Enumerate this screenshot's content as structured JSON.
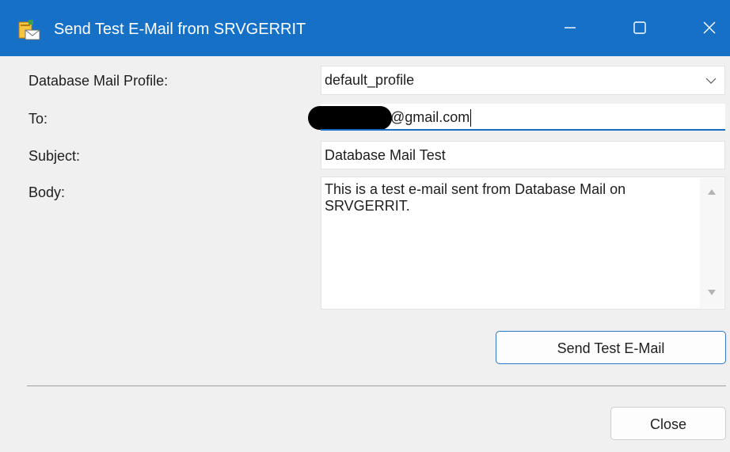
{
  "window": {
    "title": "Send Test E-Mail from SRVGERRIT",
    "controls": [
      "minimize-icon",
      "maximize-icon",
      "close-icon"
    ]
  },
  "form": {
    "profile_label": "Database Mail Profile:",
    "profile_value": "default_profile",
    "to_label": "To:",
    "to_value": "@gmail.com",
    "subject_label": "Subject:",
    "subject_value": "Database Mail Test",
    "body_label": "Body:",
    "body_value": "This is a test e-mail sent from Database Mail on SRVGERRIT."
  },
  "buttons": {
    "send_label": "Send Test E-Mail",
    "close_label": "Close"
  },
  "colors": {
    "titlebar": "#1671c6",
    "focus_underline": "#1a6dc4",
    "dialog_bg": "#f0f0f0"
  }
}
